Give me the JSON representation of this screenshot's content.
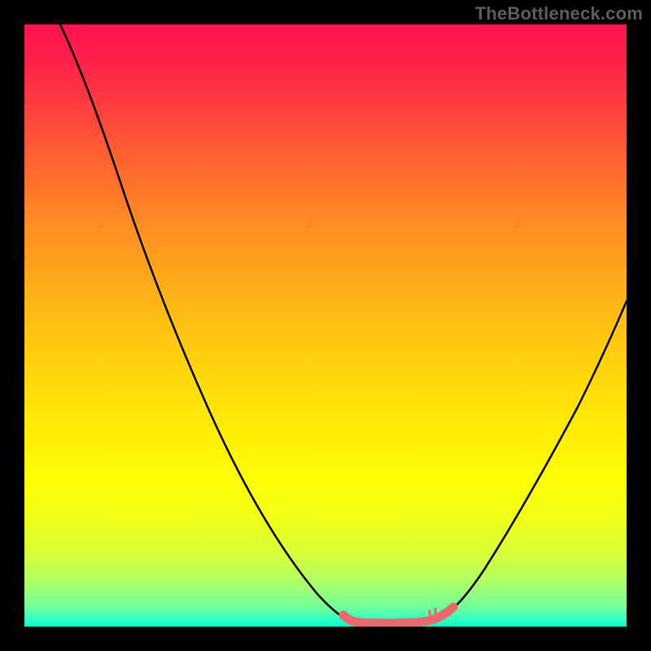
{
  "watermark": "TheBottleneck.com",
  "colors": {
    "background": "#000000",
    "watermark_text": "#5e5e5e",
    "curve": "#000000",
    "highlight": "#e86a6a",
    "gradient_top": "#ff1450",
    "gradient_bottom": "#00ffd2"
  },
  "chart_data": {
    "type": "line",
    "title": "",
    "xlabel": "",
    "ylabel": "",
    "xlim": [
      0,
      100
    ],
    "ylim": [
      0,
      100
    ],
    "grid": false,
    "legend": false,
    "series": [
      {
        "name": "bottleneck-curve-left",
        "x": [
          6,
          10,
          15,
          20,
          25,
          30,
          35,
          40,
          45,
          50,
          53
        ],
        "values": [
          100,
          92,
          82,
          72,
          62,
          51,
          40,
          28,
          16,
          6,
          2
        ]
      },
      {
        "name": "bottleneck-curve-right",
        "x": [
          70,
          75,
          80,
          85,
          90,
          95,
          100
        ],
        "values": [
          2,
          8,
          17,
          27,
          38,
          49,
          60
        ]
      },
      {
        "name": "optimal-range-highlight",
        "x": [
          53,
          56,
          60,
          64,
          68,
          70
        ],
        "values": [
          2,
          0.5,
          0.3,
          0.3,
          0.6,
          2
        ]
      }
    ]
  }
}
